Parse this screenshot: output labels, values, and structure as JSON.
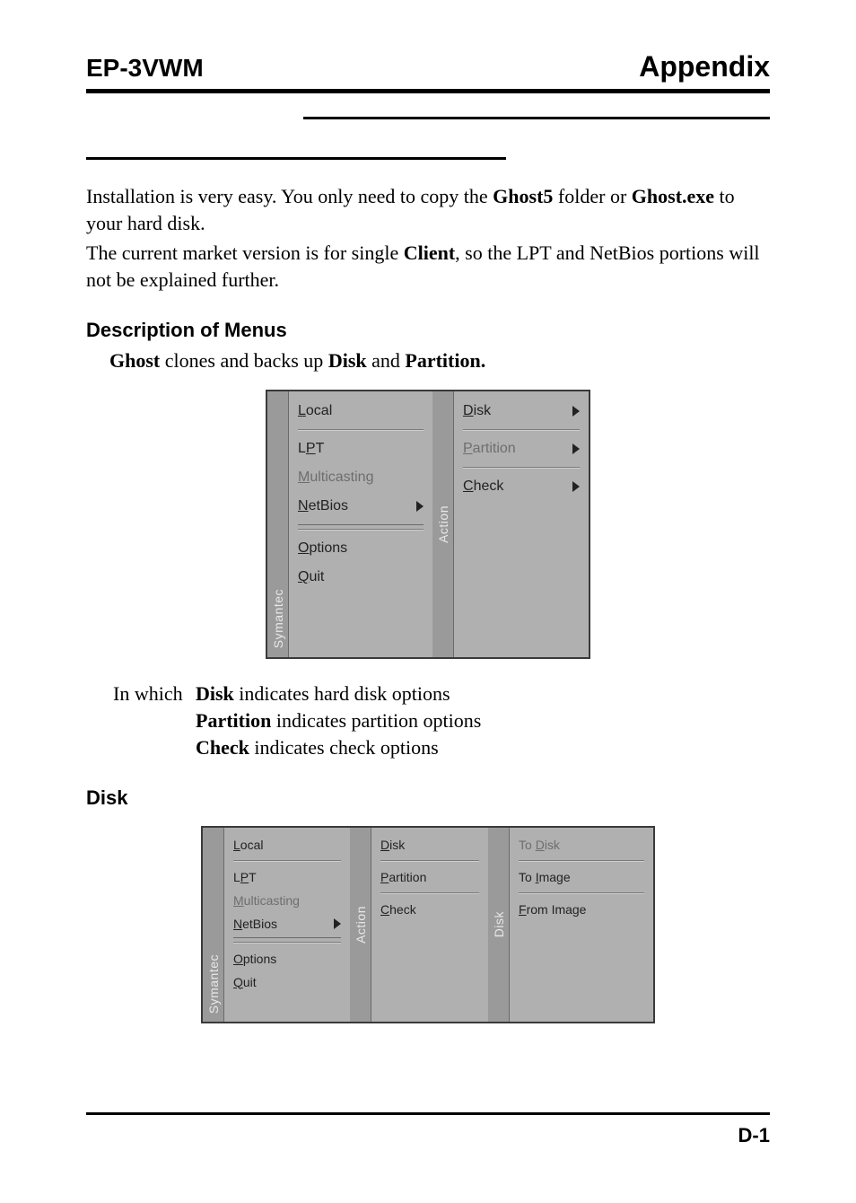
{
  "header": {
    "left": "EP-3VWM",
    "right": "Appendix"
  },
  "intro": {
    "p1a": "Installation is very easy.  You only need to copy the ",
    "p1b": "Ghost5",
    "p1c": " folder or ",
    "p1d": "Ghost.exe",
    "p1e": " to your hard disk.",
    "p2a": "The current market version is for single ",
    "p2b": "Client",
    "p2c": ", so the LPT and NetBios portions will not be explained further."
  },
  "section_menus": {
    "title": "Description of Menus",
    "line_a": "Ghost",
    "line_b": " clones and backs up ",
    "line_c": "Disk",
    "line_d": " and ",
    "line_e": "Partition."
  },
  "ui1": {
    "vtab1": "Symantec",
    "vtab2": "Action",
    "col1": {
      "local": "Local",
      "lpt": "LPT",
      "multicasting": "Multicasting",
      "netbios": "NetBios",
      "options": "Options",
      "quit": "Quit"
    },
    "col2": {
      "disk": "Disk",
      "partition": "Partition",
      "check": "Check"
    }
  },
  "expl": {
    "lead": "In which",
    "r1a": "Disk",
    "r1b": " indicates hard disk options",
    "r2a": "Partition",
    "r2b": " indicates partition options",
    "r3a": "Check",
    "r3b": " indicates check options"
  },
  "section_disk": {
    "title": "Disk"
  },
  "ui2": {
    "vtab1": "Symantec",
    "vtab2": "Action",
    "vtab3": "Disk",
    "col1": {
      "local": "Local",
      "lpt": "LPT",
      "multicasting": "Multicasting",
      "netbios": "NetBios",
      "options": "Options",
      "quit": "Quit"
    },
    "col2": {
      "disk": "Disk",
      "partition": "Partition",
      "check": "Check"
    },
    "col3": {
      "todisk": "To Disk",
      "toimage": "To Image",
      "fromimage": "From Image"
    }
  },
  "footer": {
    "pagenum": "D-1"
  }
}
